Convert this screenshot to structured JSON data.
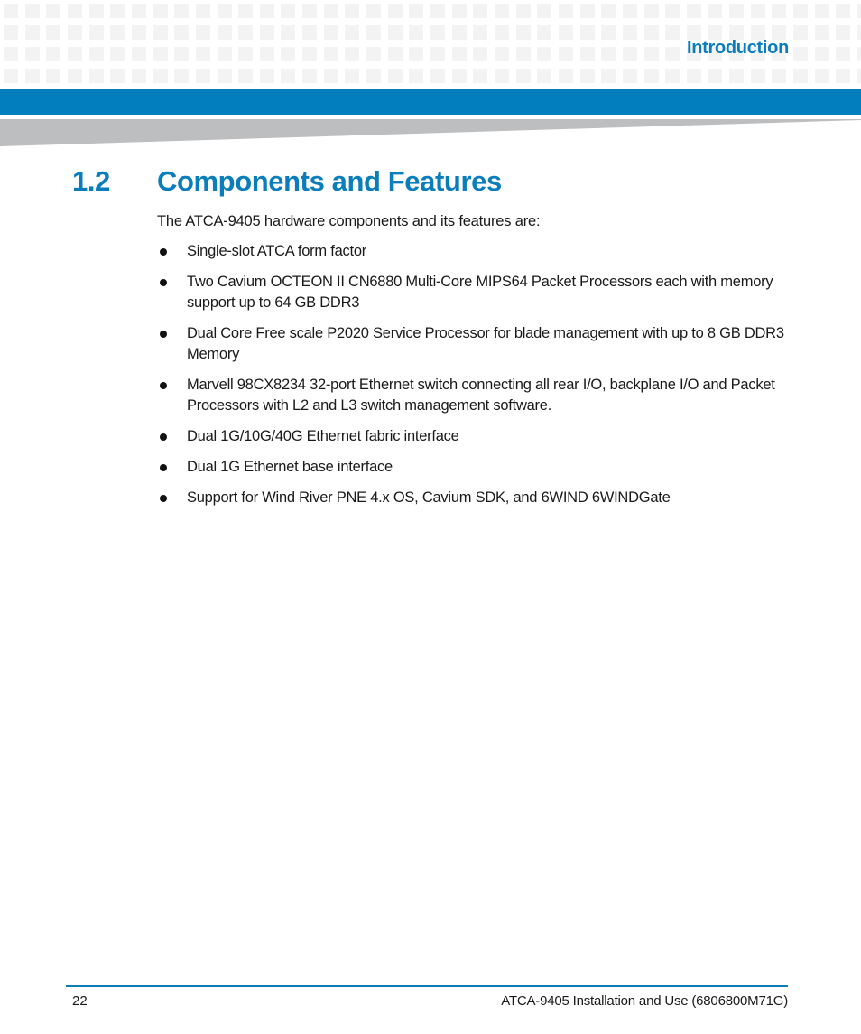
{
  "header": {
    "chapter_label": "Introduction",
    "accent_color": "#027dbd",
    "pattern_color": "#f3f3f3",
    "wedge_color": "#bdbec0"
  },
  "section": {
    "number": "1.2",
    "title": "Components and Features",
    "intro": "The ATCA-9405 hardware components and its features are:",
    "features": [
      {
        "text": "Single-slot ATCA form factor"
      },
      {
        "text": "Two Cavium OCTEON II CN6880 Multi-Core MIPS64 Packet Processors each with memory support up to 64 GB DDR3"
      },
      {
        "text": "Dual Core Free scale P2020 Service Processor for blade management with up to 8 GB DDR3 Memory"
      },
      {
        "text": "Marvell 98CX8234 32-port Ethernet switch connecting all rear I/O, backplane I/O and Packet Processors with L2 and L3 switch management software."
      },
      {
        "text": "Dual 1G/10G/40G Ethernet fabric interface"
      },
      {
        "text": "Dual 1G Ethernet base interface"
      },
      {
        "text": "Support for Wind River PNE 4.x OS, Cavium SDK, and 6WIND 6WINDGate"
      }
    ]
  },
  "footer": {
    "page_number": "22",
    "document_title": "ATCA-9405 Installation and Use (6806800M71G)"
  }
}
